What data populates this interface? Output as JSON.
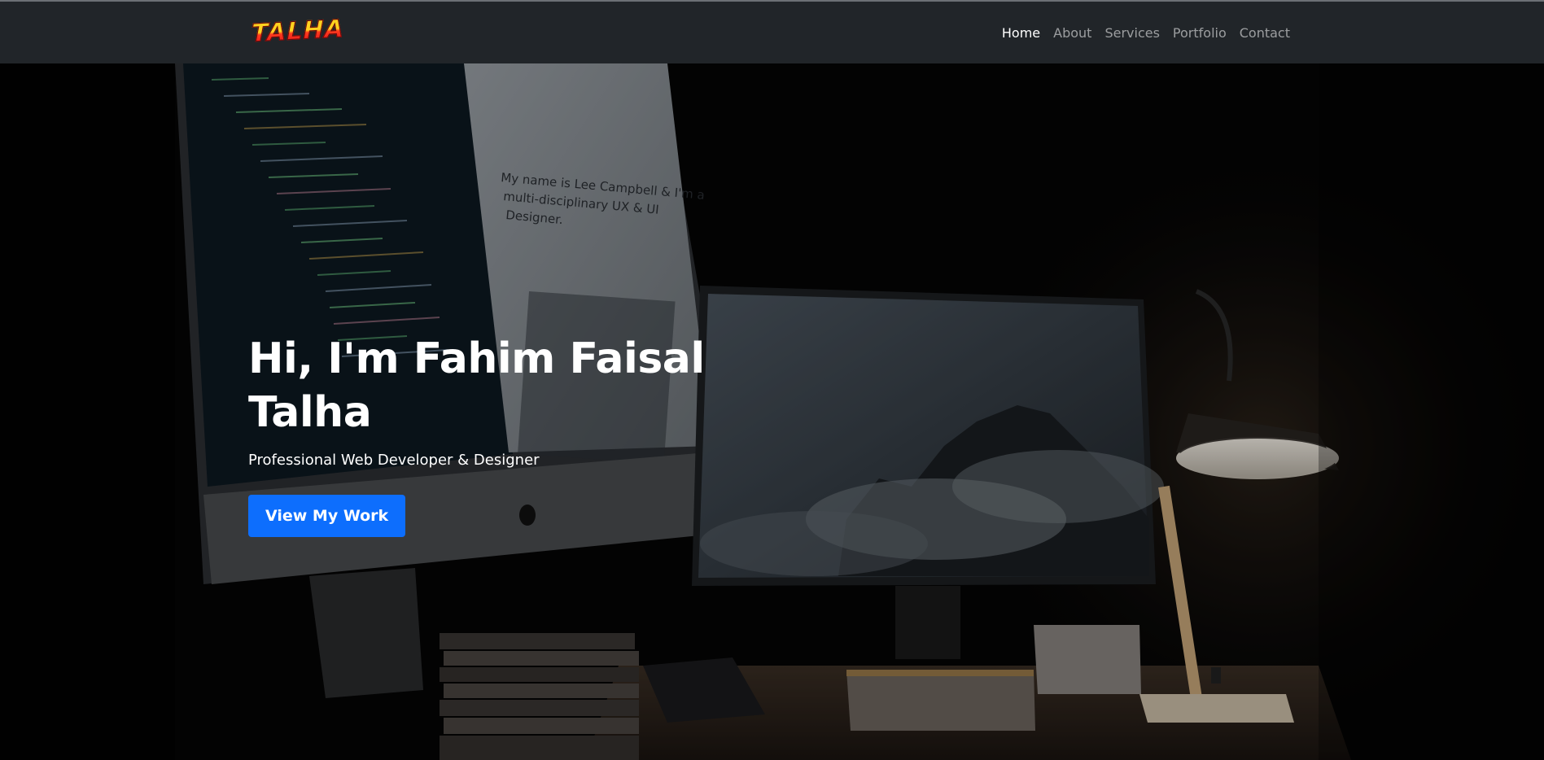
{
  "brand": {
    "logo_text": "TALHA"
  },
  "nav": {
    "items": [
      {
        "label": "Home",
        "active": true
      },
      {
        "label": "About",
        "active": false
      },
      {
        "label": "Services",
        "active": false
      },
      {
        "label": "Portfolio",
        "active": false
      },
      {
        "label": "Contact",
        "active": false
      }
    ]
  },
  "hero": {
    "title_line1": "Hi, I'm Fahim Faisal",
    "title_line2": "Talha",
    "subtitle": "Professional Web Developer & Designer",
    "button_label": "View My Work"
  },
  "background_photo": {
    "screen_text_line1": "My name is Lee Campbell & I'm a",
    "screen_text_line2": "multi-disciplinary UX & UI",
    "screen_text_line3": "Designer."
  },
  "colors": {
    "navbar_bg": "#212529",
    "button_bg": "#0d6efd",
    "nav_active": "#ffffff",
    "nav_inactive": "rgba(255,255,255,0.55)"
  }
}
